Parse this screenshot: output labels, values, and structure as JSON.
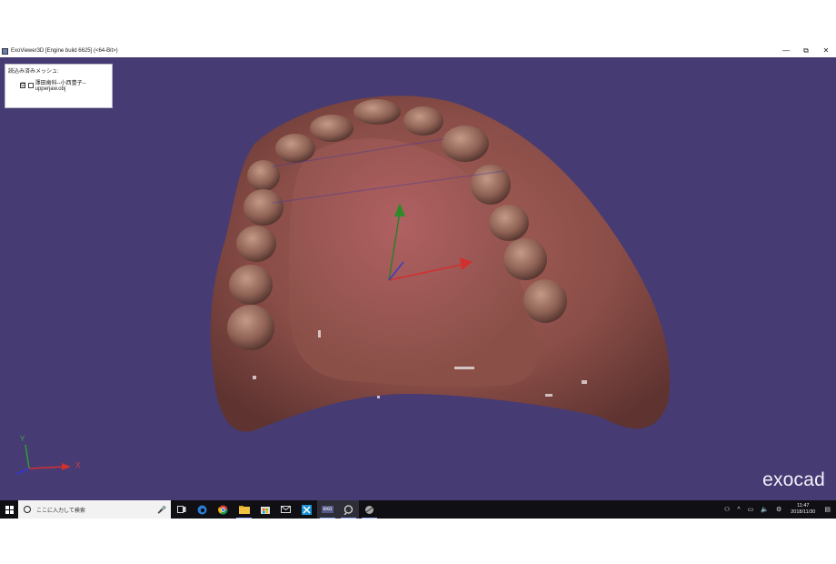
{
  "window": {
    "title": "ExoViewer3D [Engine build 6625] (<64-Bit>)",
    "minimize": "—",
    "restore": "⧉",
    "close": "✕"
  },
  "mesh_panel": {
    "title": "読込み済みメッシュ:",
    "items": [
      {
        "label": "澤田歯科--小西豊子--upperjaw.obj",
        "checked": "☑"
      }
    ]
  },
  "viewport": {
    "background": "#463b73",
    "logo": "exocad",
    "gizmo_labels": {
      "x": "X",
      "y": "Y"
    }
  },
  "taskbar": {
    "search_placeholder": "ここに入力して検索",
    "apps": [
      "task-view",
      "edge",
      "chrome",
      "file-explorer",
      "store",
      "mail",
      "exocad-app",
      "exo",
      "exoviewer",
      "misc-app"
    ],
    "exo_label": "exo",
    "clock_time": "11:47",
    "clock_date": "2018/11/30"
  }
}
